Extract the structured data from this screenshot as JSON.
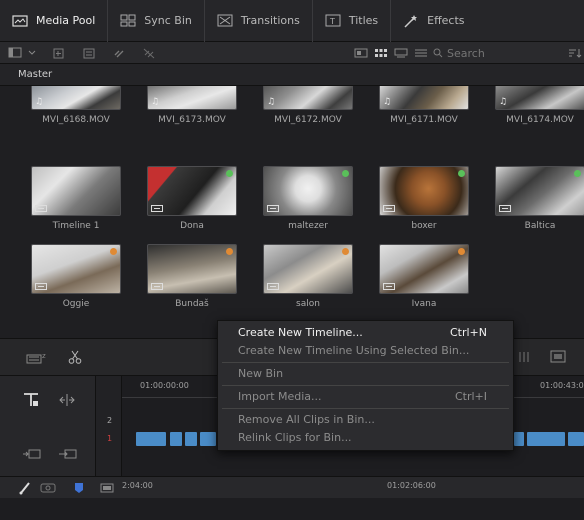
{
  "tabs": [
    {
      "label": "Media Pool",
      "active": true
    },
    {
      "label": "Sync Bin"
    },
    {
      "label": "Transitions"
    },
    {
      "label": "Titles"
    },
    {
      "label": "Effects"
    }
  ],
  "search": {
    "placeholder": "Search"
  },
  "bin": {
    "title": "Master"
  },
  "clips": [
    {
      "name": "MVI_6168.MOV",
      "kind": "video"
    },
    {
      "name": "MVI_6173.MOV",
      "kind": "video"
    },
    {
      "name": "MVI_6172.MOV",
      "kind": "video"
    },
    {
      "name": "MVI_6171.MOV",
      "kind": "video"
    },
    {
      "name": "MVI_6174.MOV",
      "kind": "video"
    },
    {
      "name": "Timeline 1",
      "kind": "timeline"
    },
    {
      "name": "Dona",
      "kind": "timeline"
    },
    {
      "name": "maltezer",
      "kind": "timeline"
    },
    {
      "name": "boxer",
      "kind": "timeline"
    },
    {
      "name": "Baltica",
      "kind": "timeline"
    },
    {
      "name": "Oggie",
      "kind": "timeline"
    },
    {
      "name": "Bundaš",
      "kind": "timeline"
    },
    {
      "name": "salon",
      "kind": "timeline"
    },
    {
      "name": "Ivana",
      "kind": "timeline"
    }
  ],
  "timeline": {
    "track_numbers": [
      "2",
      "1"
    ],
    "ruler_start": "01:00:00:00",
    "ruler_right": "01:00:43:0",
    "bottom_left": "2:04:00",
    "bottom_mid": "01:02:06:00"
  },
  "context_menu": {
    "items": [
      {
        "label": "Create New Timeline...",
        "shortcut": "Ctrl+N",
        "enabled": true
      },
      {
        "label": "Create New Timeline Using Selected Bin...",
        "shortcut": "",
        "enabled": false
      },
      {
        "separator": true
      },
      {
        "label": "New Bin",
        "shortcut": "",
        "enabled": false
      },
      {
        "separator": true
      },
      {
        "label": "Import Media...",
        "shortcut": "Ctrl+I",
        "enabled": false
      },
      {
        "separator": true
      },
      {
        "label": "Remove All Clips in Bin...",
        "shortcut": "",
        "enabled": false
      },
      {
        "label": "Relink Clips for Bin...",
        "shortcut": "",
        "enabled": false
      }
    ]
  },
  "colors": {
    "accent_blue": "#4a8cc7",
    "green_dot": "#5ac05a",
    "orange_dot": "#e08a34",
    "red_flag": "#d03a3a"
  }
}
